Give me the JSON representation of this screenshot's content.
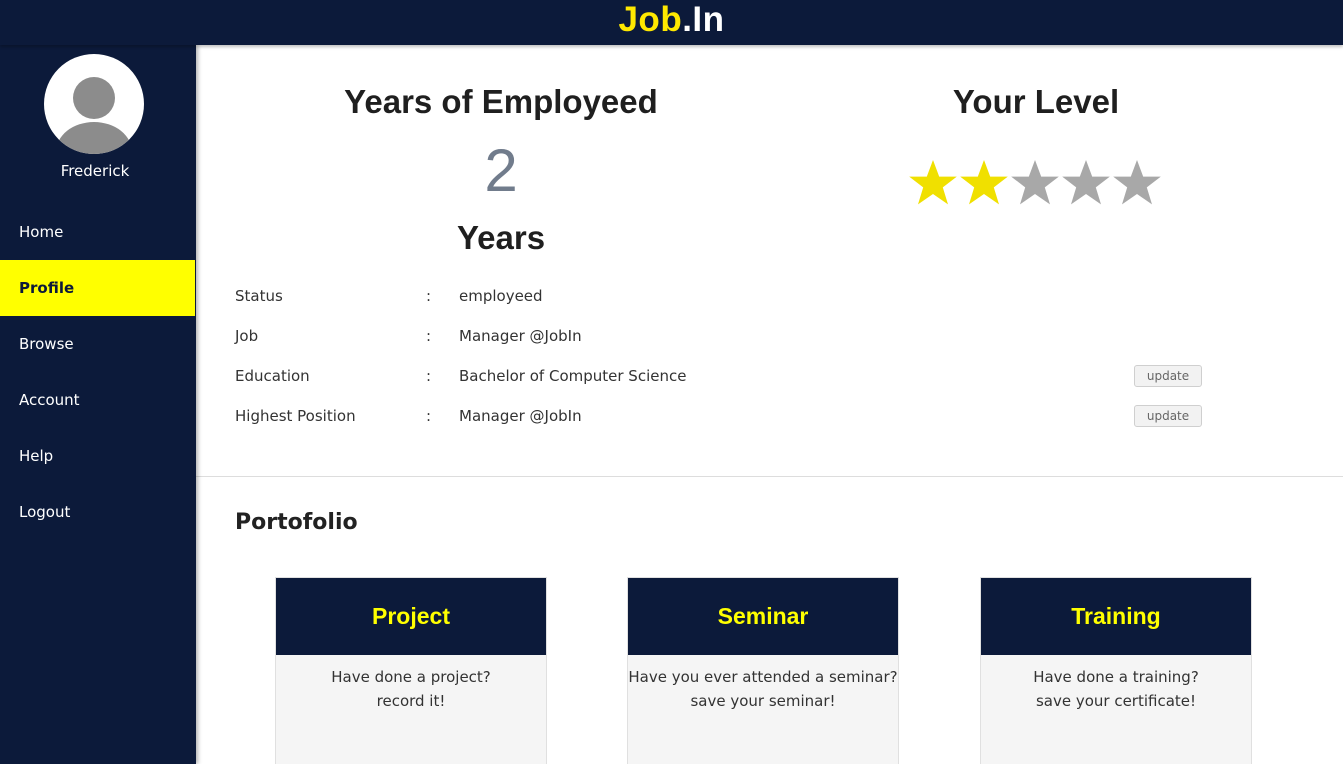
{
  "brand": {
    "part1": "Job",
    "part2": ".In"
  },
  "user": {
    "name": "Frederick"
  },
  "nav": {
    "items": [
      {
        "label": "Home"
      },
      {
        "label": "Profile",
        "active": true
      },
      {
        "label": "Browse"
      },
      {
        "label": "Account"
      },
      {
        "label": "Help"
      },
      {
        "label": "Logout"
      }
    ]
  },
  "employment": {
    "title": "Years of Employeed",
    "years": "2",
    "unit": "Years"
  },
  "level": {
    "title": "Your Level",
    "rating": 2,
    "max": 5
  },
  "info": {
    "rows": [
      {
        "label": "Status",
        "sep": ":",
        "value": "employeed"
      },
      {
        "label": "Job",
        "sep": ":",
        "value": "Manager @JobIn"
      },
      {
        "label": "Education",
        "sep": ":",
        "value": "Bachelor of Computer Science",
        "action": "update"
      },
      {
        "label": "Highest Position",
        "sep": ":",
        "value": "Manager @JobIn",
        "action": "update"
      }
    ]
  },
  "portfolio": {
    "title": "Portofolio",
    "cards": [
      {
        "title": "Project",
        "line1": "Have done a project?",
        "line2": "record it!"
      },
      {
        "title": "Seminar",
        "line1": "Have you ever attended a seminar?",
        "line2": "save your seminar!"
      },
      {
        "title": "Training",
        "line1": "Have done a training?",
        "line2": "save your certificate!"
      }
    ]
  },
  "colors": {
    "navy": "#0c1a3a",
    "accent": "#ffff00",
    "star_filled": "#f0e000",
    "star_empty": "#a8a8a8"
  }
}
